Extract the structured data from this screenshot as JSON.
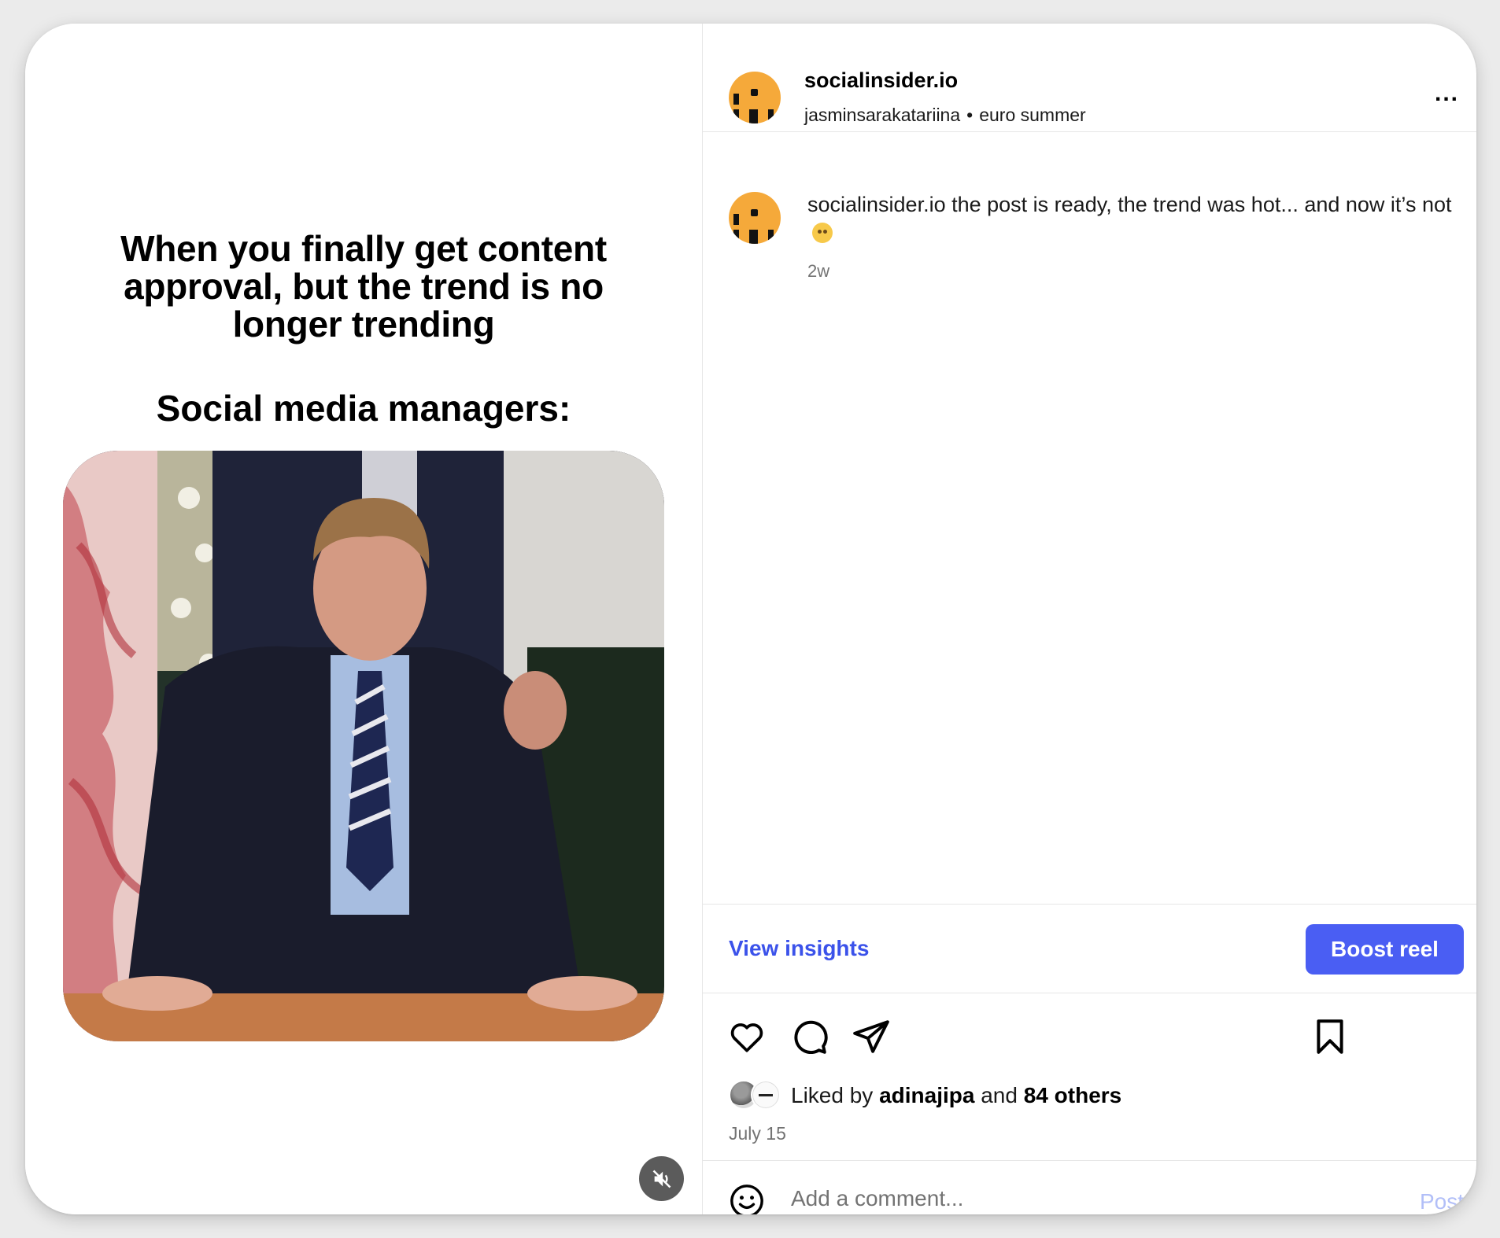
{
  "meme": {
    "caption": "When you finally get content approval, but the trend is no longer trending",
    "caption2": "Social media managers:"
  },
  "header": {
    "username": "socialinsider.io",
    "audio_author": "jasminsarakatariina",
    "separator": "•",
    "audio_title": "euro summer",
    "more": "..."
  },
  "comment": {
    "username": "socialinsider.io",
    "text": "the post is ready, the trend was hot... and now it’s not",
    "time": "2w"
  },
  "insights": {
    "view_insights": "View insights",
    "boost": "Boost reel"
  },
  "likes": {
    "prefix": "Liked by",
    "user": "adinajipa",
    "middle": "and",
    "others": "84 others",
    "date": "July 15"
  },
  "add_comment": {
    "placeholder": "Add a comment...",
    "post": "Post"
  },
  "colors": {
    "accent": "#4a5ef3",
    "link": "#3b52ea",
    "avatar": "#f5a93a"
  },
  "icons": [
    "heart-icon",
    "comment-icon",
    "share-icon",
    "bookmark-icon",
    "emoji-icon",
    "mute-icon",
    "more-icon"
  ]
}
